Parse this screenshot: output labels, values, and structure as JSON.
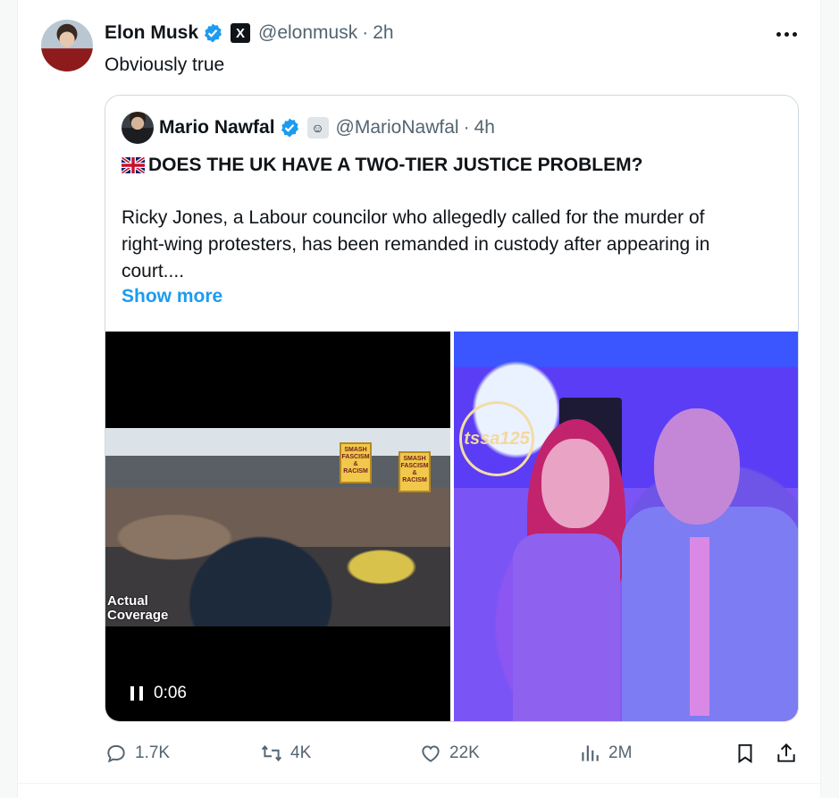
{
  "author": {
    "name": "Elon Musk",
    "handle": "@elonmusk",
    "time": "2h",
    "badge": "X"
  },
  "tweet": {
    "text": "Obviously true"
  },
  "quote": {
    "name": "Mario Nawfal",
    "handle": "@MarioNawfal",
    "time": "4h",
    "title": "DOES THE UK HAVE A TWO-TIER JUSTICE PROBLEM?",
    "body_line1": "Ricky Jones, a Labour councilor who allegedly called for the murder of",
    "body_line2": "right-wing protesters, has been remanded in custody after appearing in",
    "body_line3": "court....",
    "show_more": "Show more",
    "video": {
      "overlay_line1": "Actual",
      "overlay_line2": "Coverage",
      "duration": "0:06",
      "sign1": "SMASH FASCISM & RACISM",
      "sign2": "SMASH FASCISM & RACISM"
    },
    "photo": {
      "logo_text": "tssa125"
    }
  },
  "actions": {
    "replies": "1.7K",
    "reposts": "4K",
    "likes": "22K",
    "views": "2M"
  },
  "icons": [
    "verified-badge-icon",
    "x-logo-icon",
    "more-icon",
    "uk-flag-icon",
    "reply-icon",
    "repost-icon",
    "like-icon",
    "views-icon",
    "bookmark-icon",
    "share-icon",
    "pause-icon"
  ],
  "colors": {
    "accent": "#1d9bf0",
    "text_secondary": "#536471",
    "border": "#cfd9de"
  }
}
